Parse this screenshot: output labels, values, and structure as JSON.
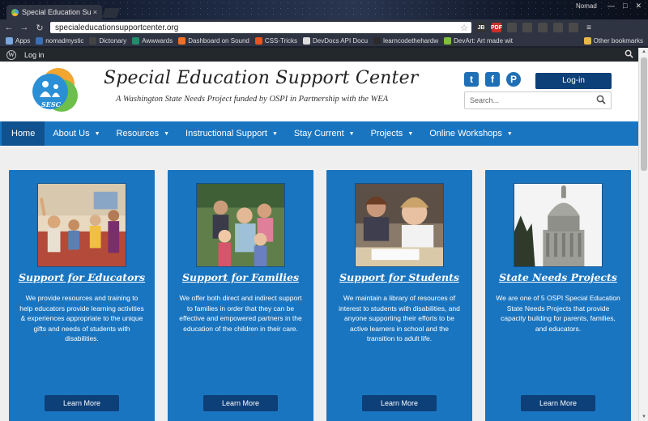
{
  "browser": {
    "tab_title": "Special Education Suppor",
    "tab_close": "×",
    "profile": "Nomad",
    "window_controls": [
      "—",
      "□",
      "✕"
    ],
    "url": "specialeducationsupportcenter.org",
    "extensions": [
      {
        "label": "JB",
        "color": "#333333"
      },
      {
        "label": "PDF",
        "color": "#c9302c"
      },
      {
        "label": "",
        "color": "#4a4a4a"
      },
      {
        "label": "",
        "color": "#4a4a4a"
      },
      {
        "label": "",
        "color": "#4a4a4a"
      },
      {
        "label": "",
        "color": "#4a4a4a"
      },
      {
        "label": "",
        "color": "#4a4a4a"
      }
    ],
    "bookmarks": [
      {
        "label": "Apps",
        "color": "#7aa7e0"
      },
      {
        "label": "nomadmystic",
        "color": "#3b6fb3"
      },
      {
        "label": "Dictonary",
        "color": "#444444"
      },
      {
        "label": "Awwwards",
        "color": "#1f8f6b"
      },
      {
        "label": "Dashboard on Sound",
        "color": "#f26f21"
      },
      {
        "label": "CSS-Tricks",
        "color": "#e8541d"
      },
      {
        "label": "DevDocs API Docu",
        "color": "#dddddd"
      },
      {
        "label": "learncodethehardw",
        "color": "#2b2b2b"
      },
      {
        "label": "DevArt: Art made wit",
        "color": "#7fbf3b"
      }
    ],
    "other_bookmarks": "Other bookmarks"
  },
  "adminbar": {
    "wp_logo": "W",
    "login": "Log in"
  },
  "header": {
    "logo_text": "SESC",
    "site_title": "Special Education Support Center",
    "tagline": "A Washington State Needs Project funded by OSPI in Partnership with the WEA",
    "social": {
      "twitter": "t",
      "facebook": "f",
      "pinterest": "P"
    },
    "login_button": "Log-in",
    "search_placeholder": "Search..."
  },
  "nav": {
    "items": [
      {
        "label": "Home",
        "has_caret": false
      },
      {
        "label": "About Us",
        "has_caret": true
      },
      {
        "label": "Resources",
        "has_caret": true
      },
      {
        "label": "Instructional Support",
        "has_caret": true
      },
      {
        "label": "Stay Current",
        "has_caret": true
      },
      {
        "label": "Projects",
        "has_caret": true
      },
      {
        "label": "Online Workshops",
        "has_caret": true
      }
    ],
    "caret": "▼",
    "active_index": 0
  },
  "cards": [
    {
      "title": "Support for Educators",
      "text": "We provide resources and training to help educators provide learning activities & experiences appropriate to the unique gifts and needs of students with disabilities.",
      "button": "Learn More"
    },
    {
      "title": "Support for Families",
      "text": "We offer both direct and indirect support to families in order that they can be effective and empowered partners in the education of the children in their care.",
      "button": "Learn More"
    },
    {
      "title": "Support for Students",
      "text": "We maintain a library of resources of interest to students with disabilities, and anyone supporting their efforts to be active learners in school and the transition to adult life.",
      "button": "Learn More"
    },
    {
      "title": "State Needs Projects",
      "text": "We are one of 5 OSPI Special Education State Needs Projects that provide capacity building for parents, families, and educators.",
      "button": "Learn More"
    }
  ],
  "colors": {
    "brand_blue": "#1a75c0",
    "nav_active": "#0f528f",
    "button_dark": "#0d3f78"
  }
}
